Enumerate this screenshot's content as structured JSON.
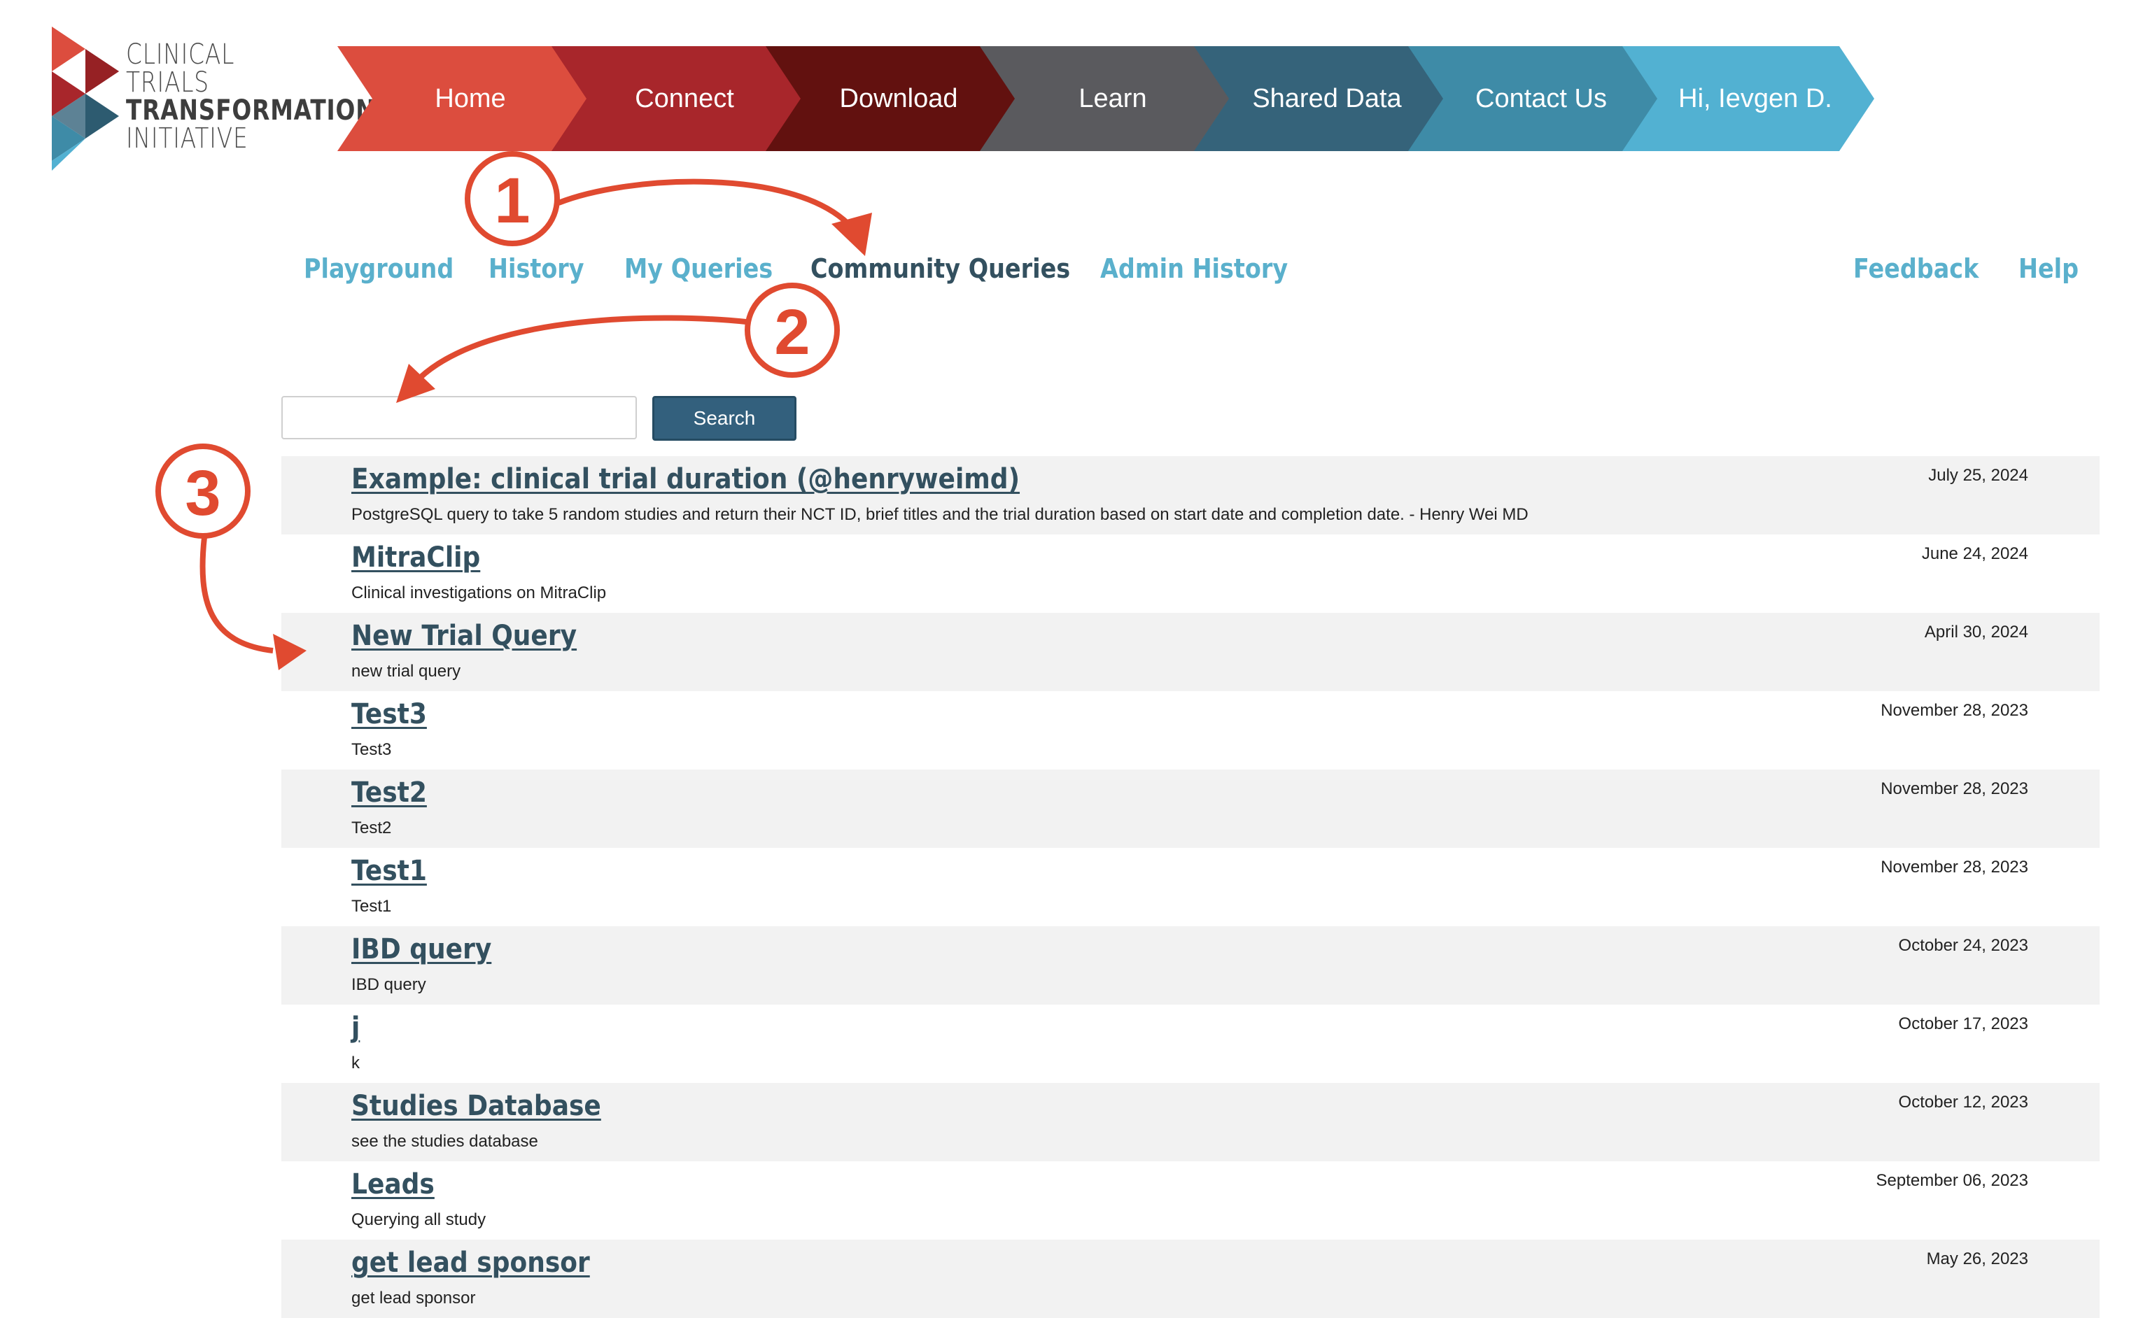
{
  "logo": {
    "line1": "CLINICAL",
    "line2": "TRIALS",
    "line3": "TRANSFORMATION",
    "line4": "INITIATIVE"
  },
  "topnav": [
    {
      "label": "Home",
      "color": "#dc4d3e"
    },
    {
      "label": "Connect",
      "color": "#a8262b"
    },
    {
      "label": "Download",
      "color": "#62110f"
    },
    {
      "label": "Learn",
      "color": "#5a5a5e"
    },
    {
      "label": "Shared Data",
      "color": "#35637a"
    },
    {
      "label": "Contact Us",
      "color": "#3e8ba7"
    },
    {
      "label": "Hi, Ievgen D.",
      "color": "#52b1d2"
    }
  ],
  "subnav": {
    "playground": "Playground",
    "history": "History",
    "my_queries": "My Queries",
    "community_queries": "Community Queries",
    "admin_history": "Admin History",
    "feedback": "Feedback",
    "help": "Help"
  },
  "search": {
    "value": "",
    "placeholder": "",
    "button_label": "Search"
  },
  "queries": [
    {
      "title": "Example: clinical trial duration (@henryweimd)",
      "description": "PostgreSQL query to take 5 random studies and return their NCT ID, brief titles and the trial duration based on start date and completion date. - Henry Wei MD",
      "date": "July 25, 2024"
    },
    {
      "title": "MitraClip",
      "description": "Clinical investigations on MitraClip",
      "date": "June 24, 2024"
    },
    {
      "title": "New Trial Query",
      "description": "new trial query",
      "date": "April 30, 2024"
    },
    {
      "title": "Test3",
      "description": "Test3",
      "date": "November 28, 2023"
    },
    {
      "title": "Test2",
      "description": "Test2",
      "date": "November 28, 2023"
    },
    {
      "title": "Test1",
      "description": "Test1",
      "date": "November 28, 2023"
    },
    {
      "title": "IBD query",
      "description": "IBD query",
      "date": "October 24, 2023"
    },
    {
      "title": "j",
      "description": "k",
      "date": "October 17, 2023"
    },
    {
      "title": "Studies Database",
      "description": "see the studies database",
      "date": "October 12, 2023"
    },
    {
      "title": "Leads",
      "description": "Querying all study",
      "date": "September 06, 2023"
    },
    {
      "title": "get lead sponsor",
      "description": "get lead sponsor",
      "date": "May 26, 2023"
    }
  ],
  "annotations": {
    "step1": "1",
    "step2": "2",
    "step3": "3",
    "color": "#e04a30"
  },
  "colors": {
    "link_accent": "#5ab0cc",
    "active_link": "#33505f",
    "search_button": "#33607d",
    "row_alt_bg": "#f2f2f2"
  }
}
